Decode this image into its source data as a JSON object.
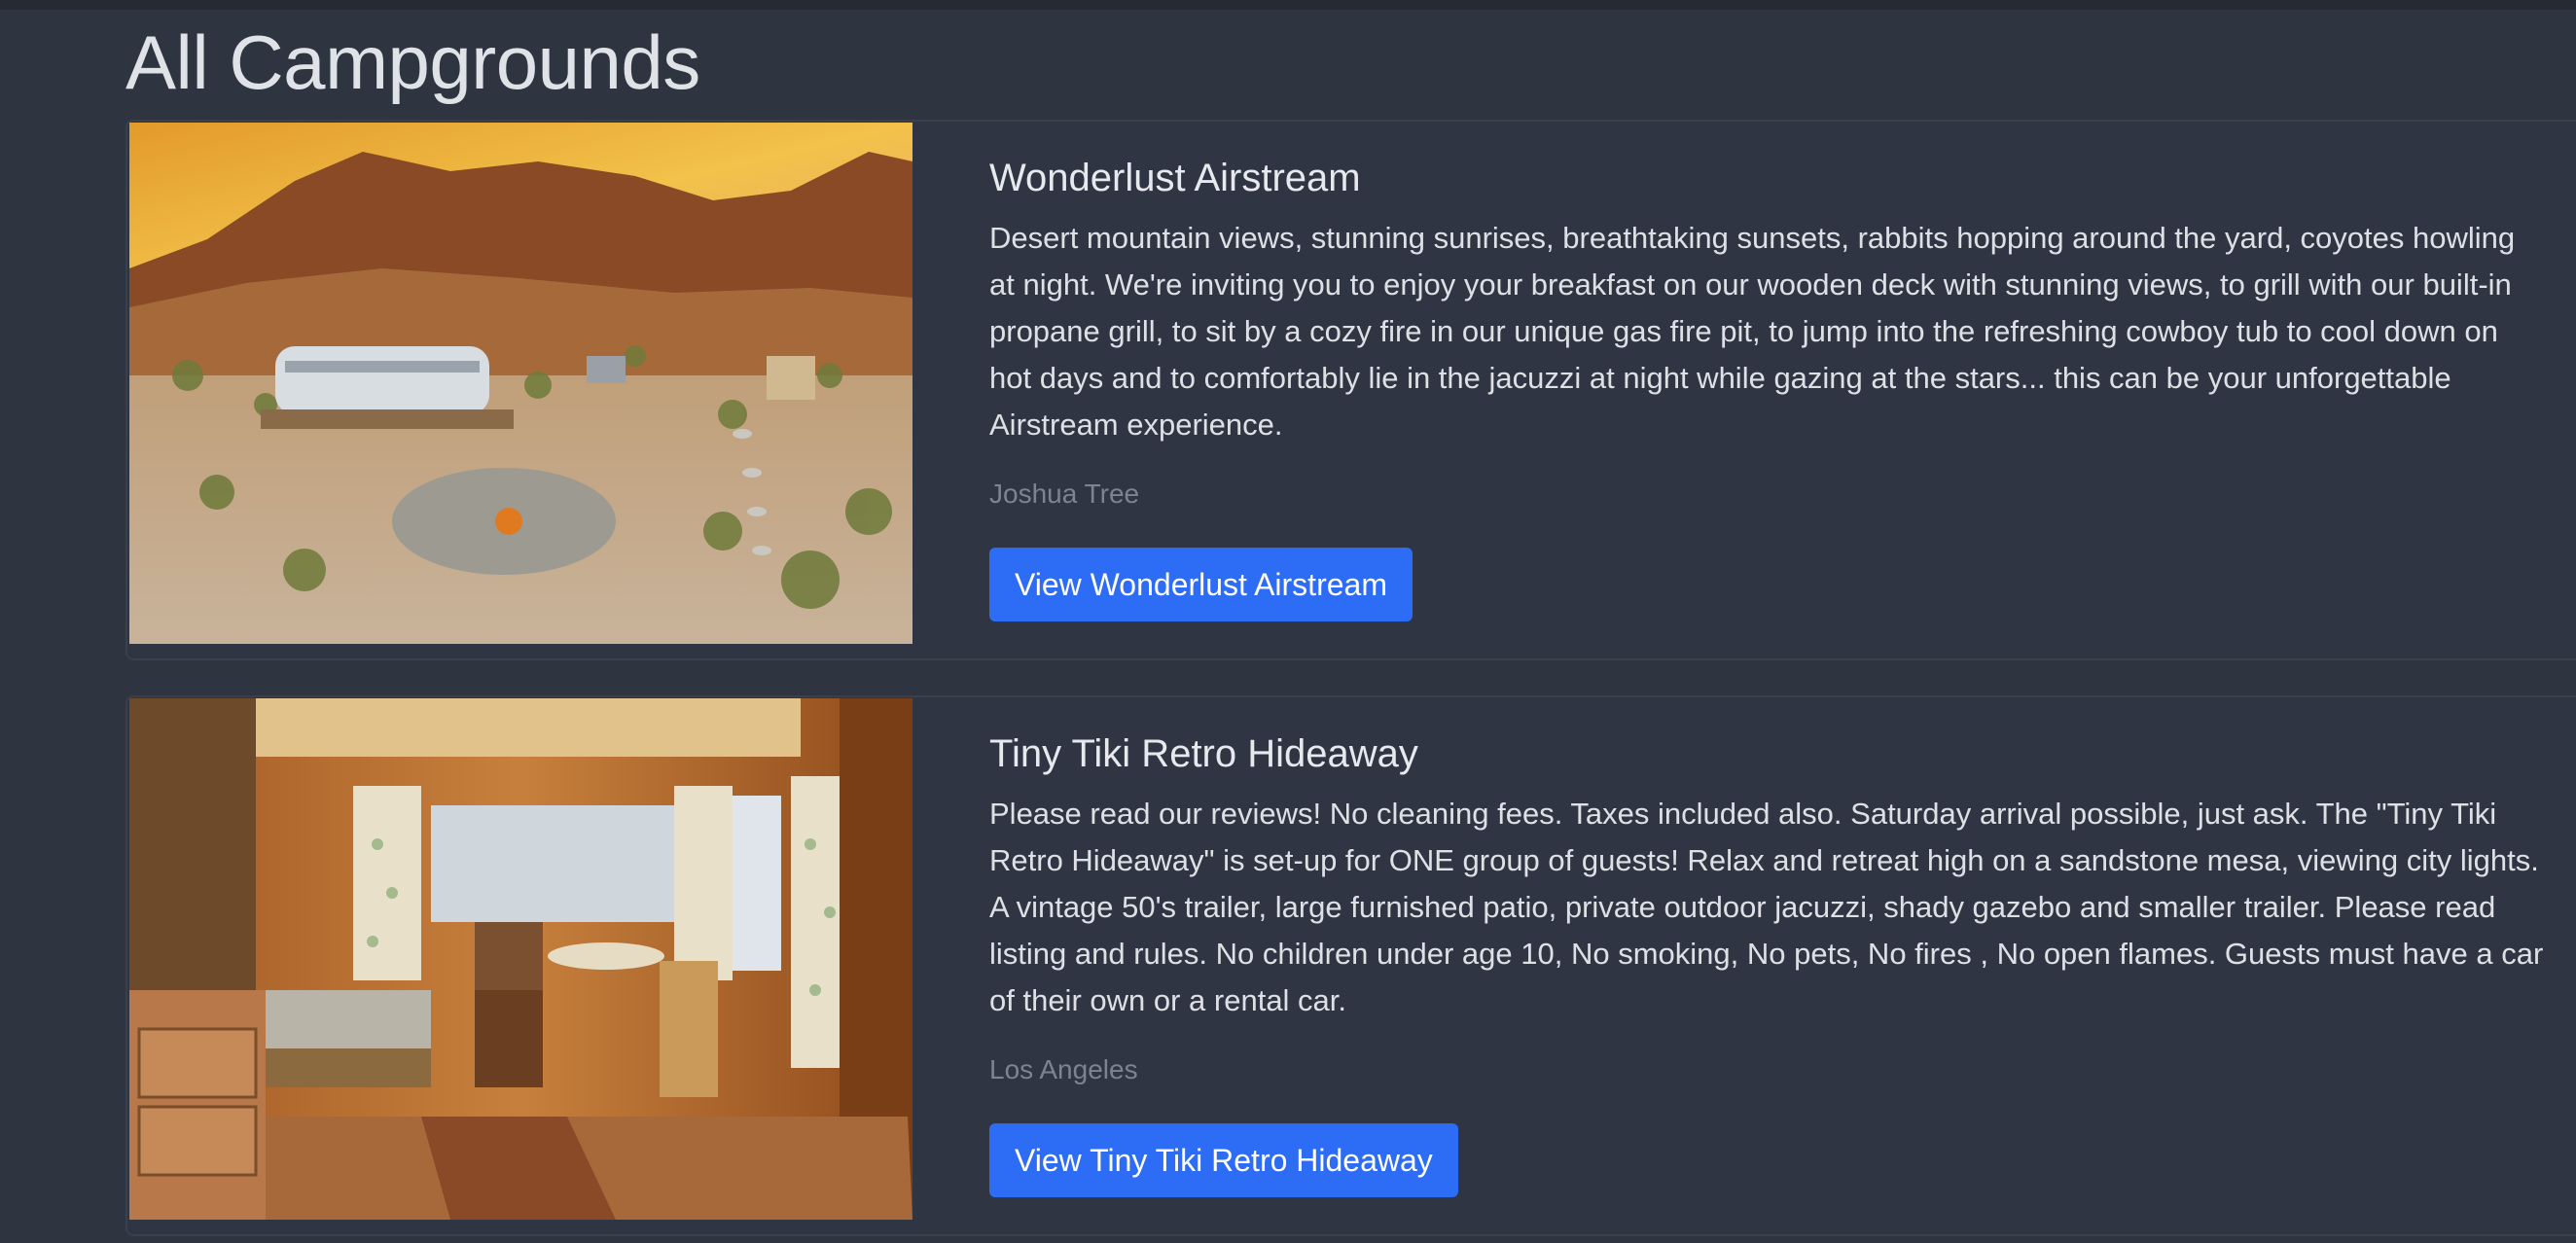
{
  "page": {
    "title": "All Campgrounds"
  },
  "campgrounds": [
    {
      "title": "Wonderlust Airstream",
      "description": "Desert mountain views, stunning sunrises, breathtaking sunsets, rabbits hopping around the yard, coyotes howling at night. We're inviting you to enjoy your breakfast on our wooden deck with stunning views, to grill with our built-in propane grill, to sit by a cozy fire in our unique gas fire pit, to jump into the refreshing cowboy tub to cool down on hot days and to comfortably lie in the jacuzzi at night while gazing at the stars... this can be your unforgettable Airstream experience.",
      "location": "Joshua Tree",
      "button_label": "View Wonderlust Airstream"
    },
    {
      "title": "Tiny Tiki Retro Hideaway",
      "description": "Please read our reviews! No cleaning fees. Taxes included also. Saturday arrival possible, just ask. The \"Tiny Tiki Retro Hideaway\" is set-up for ONE group of guests! Relax and retreat high on a sandstone mesa, viewing city lights. A vintage 50's trailer, large furnished patio, private outdoor jacuzzi, shady gazebo and smaller trailer. Please read listing and rules. No children under age 10, No smoking, No pets, No fires , No open flames. Guests must have a car of their own or a rental car.",
      "location": "Los Angeles",
      "button_label": "View Tiny Tiki Retro Hideaway"
    }
  ],
  "theme": {
    "background": "#2e3440",
    "card_background": "#2f3542",
    "accent": "#2d6cf5",
    "muted_text": "#7c8490"
  }
}
